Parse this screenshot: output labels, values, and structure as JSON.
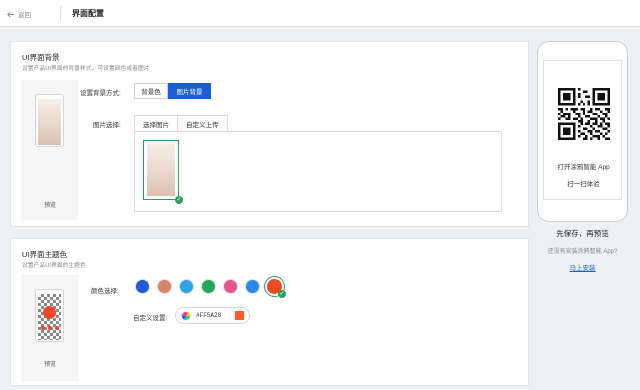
{
  "topbar": {
    "back_label": "返回",
    "title": "界面配置"
  },
  "background_section": {
    "title": "UI界面背景",
    "subtitle": "设置产品UI界面的背景样式，可设置颜色或者图片",
    "preview_label": "预览",
    "mode_label": "设置背景方式:",
    "mode_options": [
      "背景色",
      "图片背景"
    ],
    "mode_selected": "图片背景",
    "image_label": "图片选择:",
    "image_tabs": [
      "选择图片",
      "自定义上传"
    ],
    "image_tab_selected": "选择图片"
  },
  "theme_section": {
    "title": "UI界面主题色",
    "subtitle": "设置产品UI界面的主题色",
    "preview_label": "预览",
    "color_label": "颜色选择:",
    "colors": [
      "#2159d6",
      "#d9826a",
      "#2ea3e6",
      "#26a65b",
      "#e6558a",
      "#2b8ae6",
      "#f04a25"
    ],
    "selected_color": "#f04a25",
    "custom_label": "自定义设置:",
    "custom_hex": "#FF5A28",
    "custom_color": "#FF5A28"
  },
  "side": {
    "scan_text": "打开涂鸦智能 App",
    "scan_sub": "扫一扫体验",
    "save_preview": "先保存，再预览",
    "no_app": "还没有安装涂鸦智能 App?",
    "install": "马上安装"
  },
  "colors": {
    "primary": "#1a5fd6",
    "success": "#2e9e5b"
  }
}
